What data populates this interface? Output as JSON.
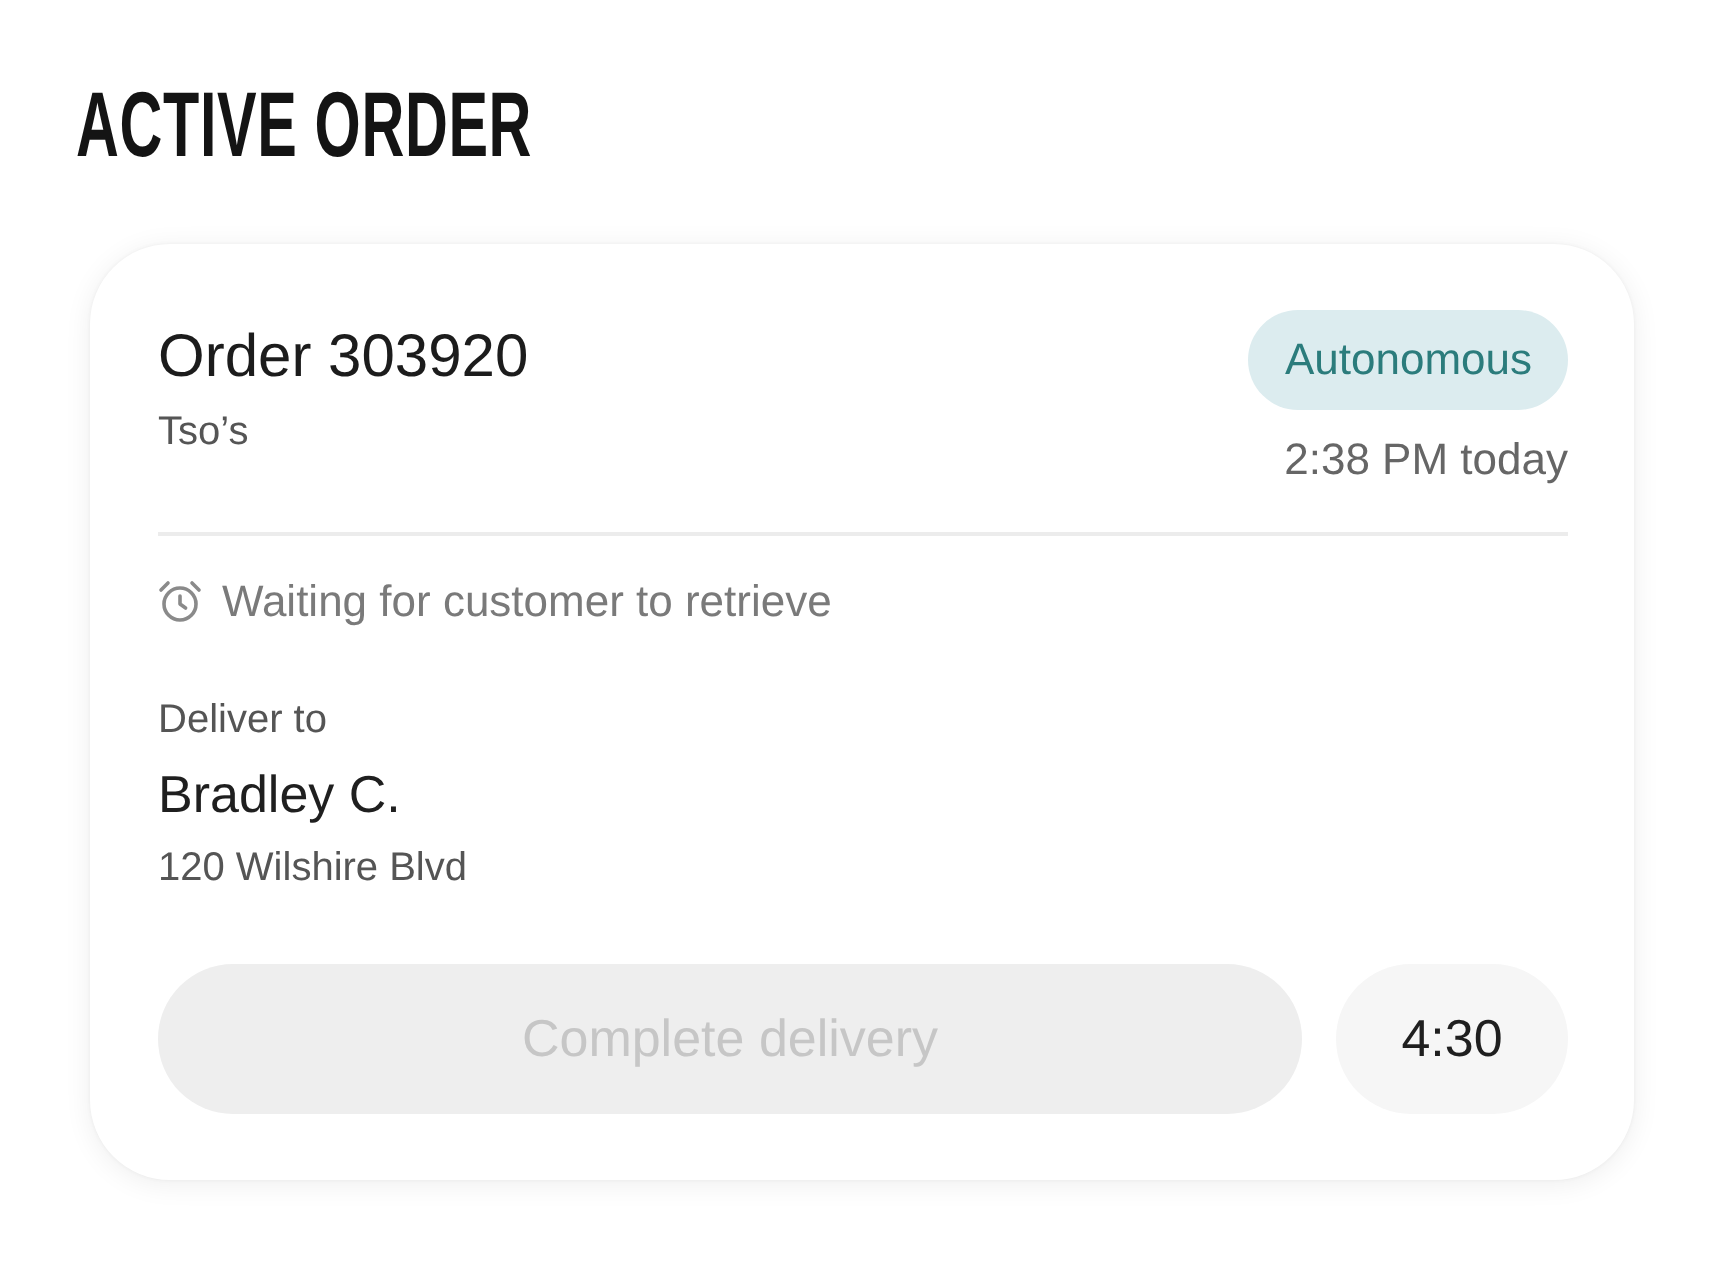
{
  "heading": "ACTIVE ORDER",
  "order": {
    "title": "Order 303920",
    "restaurant": "Tso’s",
    "badge": "Autonomous",
    "time": "2:38 PM today"
  },
  "status": {
    "text": "Waiting for customer to retrieve"
  },
  "delivery": {
    "label": "Deliver to",
    "name": "Bradley C.",
    "address": "120 Wilshire Blvd"
  },
  "actions": {
    "primary": {
      "label": "Complete delivery",
      "disabled": true
    },
    "timer": "4:30"
  }
}
